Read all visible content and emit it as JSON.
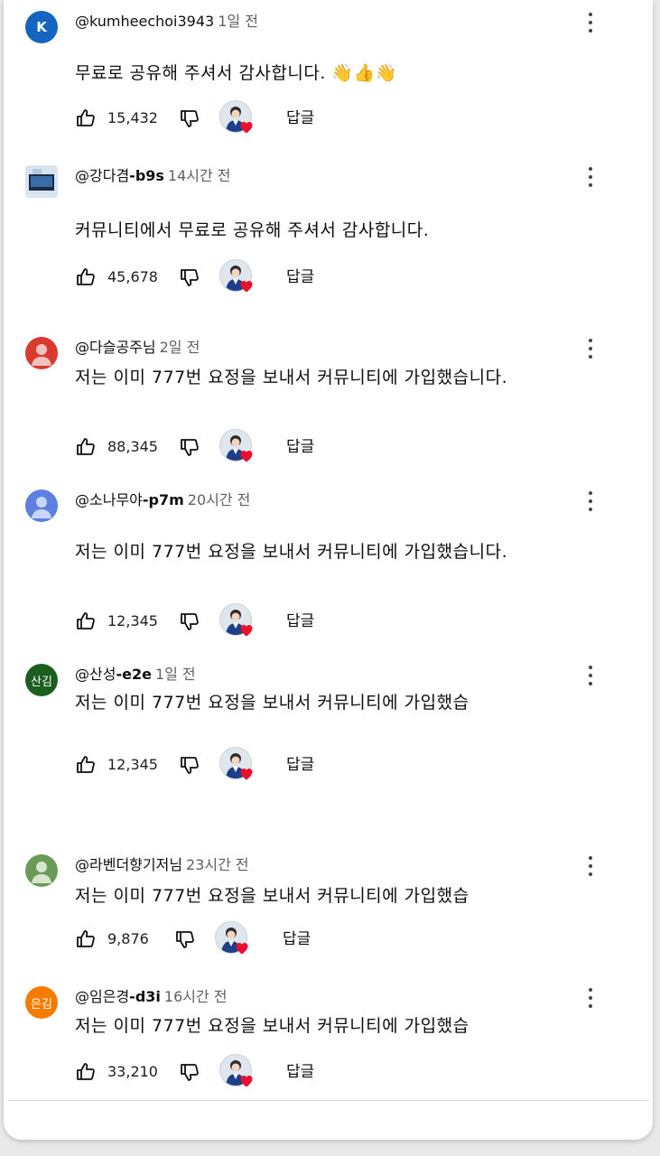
{
  "reply_label": "답글",
  "colors": {
    "heart": "#e8112d",
    "meta": "#606060"
  },
  "comments": [
    {
      "avatar_letter": "K",
      "avatar_color": "#1565c0",
      "handle": "@kumheechoi3943",
      "handle_bold": "",
      "time": "1일 전",
      "text": "무료로 공유해 주셔서 감사합니다. 👋👍👋",
      "likes": "15,432"
    },
    {
      "avatar_letter": "",
      "avatar_color": "#d8e4f0",
      "handle": "@강다겸",
      "handle_bold": "-b9s",
      "time": "14시간 전",
      "text": "커뮤니티에서 무료로 공유해 주셔서 감사합니다.",
      "likes": "45,678"
    },
    {
      "avatar_letter": "",
      "avatar_color": "#d93a2f",
      "handle": "@다슬공주님",
      "handle_bold": "",
      "time": "2일 전",
      "text": "저는 이미 777번 요정을 보내서 커뮤니티에 가입했습니다.",
      "likes": "88,345"
    },
    {
      "avatar_letter": "",
      "avatar_color": "#5c7fe0",
      "handle": "@소나무야",
      "handle_bold": "-p7m",
      "time": "20시간 전",
      "text": "저는 이미 777번 요정을 보내서 커뮤니티에 가입했습니다.",
      "likes": "12,345"
    },
    {
      "avatar_letter": "산김",
      "avatar_color": "#1b5e20",
      "handle": "@산성",
      "handle_bold": "-e2e",
      "time": "1일 전",
      "text": "저는 이미 777번 요정을 보내서 커뮤니티에 가입했습",
      "likes": "12,345"
    },
    {
      "avatar_letter": "",
      "avatar_color": "#6a9a58",
      "handle": "@라벤더향기저님",
      "handle_bold": "",
      "time": "23시간 전",
      "text": "저는 이미 777번 요정을 보내서 커뮤니티에 가입했습",
      "likes": "9,876"
    },
    {
      "avatar_letter": "은김",
      "avatar_color": "#f57c00",
      "handle": "@임은경",
      "handle_bold": "-d3i",
      "time": "16시간 전",
      "text": "저는 이미 777번 요정을 보내서 커뮤니티에 가입했습",
      "likes": "33,210"
    }
  ]
}
